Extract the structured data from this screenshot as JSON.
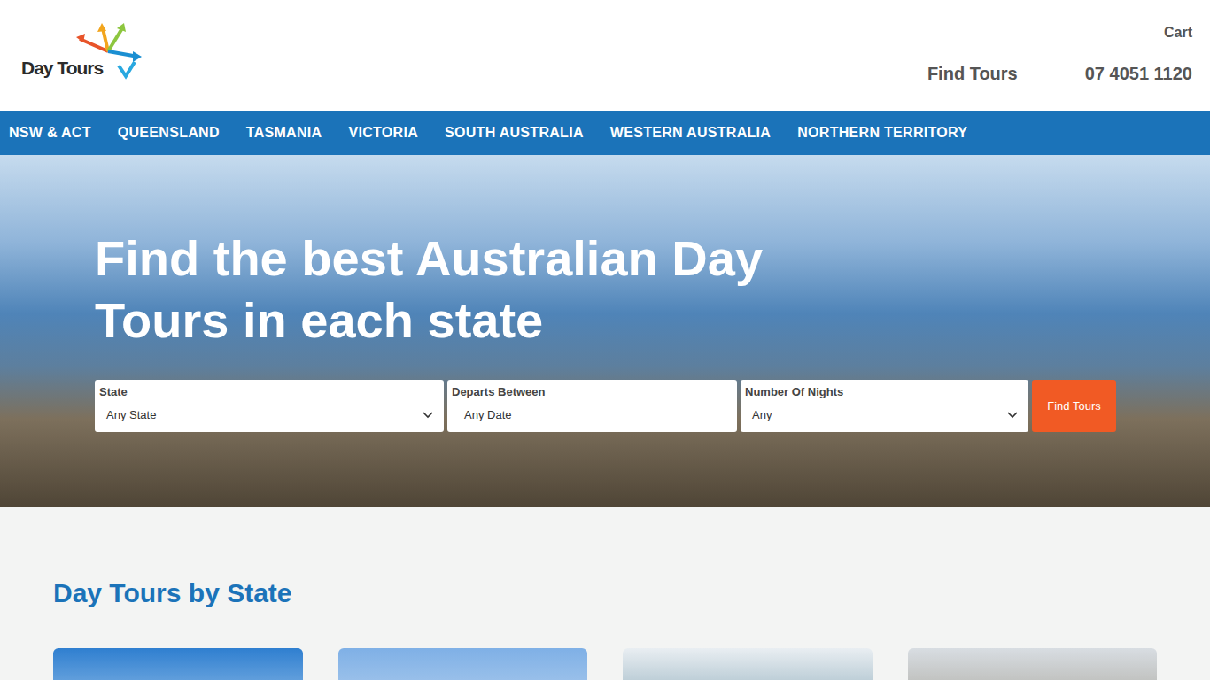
{
  "logo": {
    "text": "Day Tours"
  },
  "header": {
    "cart": "Cart",
    "find_tours": "Find Tours",
    "phone": "07 4051 1120"
  },
  "nav": [
    {
      "label": "NSW & ACT"
    },
    {
      "label": "QUEENSLAND"
    },
    {
      "label": "TASMANIA"
    },
    {
      "label": "VICTORIA"
    },
    {
      "label": "SOUTH AUSTRALIA"
    },
    {
      "label": "WESTERN AUSTRALIA"
    },
    {
      "label": "NORTHERN TERRITORY"
    }
  ],
  "hero": {
    "title": "Find the best Australian Day Tours in each state"
  },
  "search": {
    "fields": [
      {
        "label": "State",
        "value": "Any State",
        "kind": "select"
      },
      {
        "label": "Departs Between",
        "value": "Any Date",
        "kind": "date"
      },
      {
        "label": "Number Of Nights",
        "value": "Any",
        "kind": "select"
      }
    ],
    "button": "Find Tours"
  },
  "section": {
    "title": "Day Tours by State"
  }
}
